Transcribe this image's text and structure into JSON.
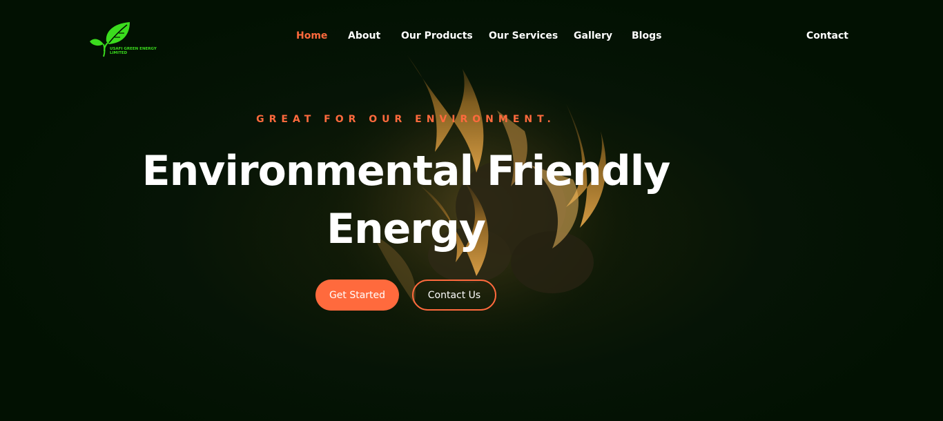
{
  "brand": {
    "name": "USAFI GREEN ENERGY LIMITED",
    "logo_icon": "leaf-icon",
    "color": "#3bdc1e"
  },
  "nav": {
    "items": [
      {
        "label": "Home",
        "active": true
      },
      {
        "label": "About",
        "active": false
      },
      {
        "label": "Our Products",
        "active": false
      },
      {
        "label": "Our Services",
        "active": false
      },
      {
        "label": "Gallery",
        "active": false
      },
      {
        "label": "Blogs",
        "active": false
      }
    ],
    "contact_label": "Contact"
  },
  "hero": {
    "tagline": "GREAT FOR OUR ENVIRONMENT.",
    "headline": "Environmental Friendly Energy",
    "primary_button": "Get Started",
    "secondary_button": "Contact Us",
    "background_image": "fire-briquettes-image"
  },
  "colors": {
    "accent": "#ff6a3d",
    "background": "#021102",
    "text": "#ffffff"
  }
}
